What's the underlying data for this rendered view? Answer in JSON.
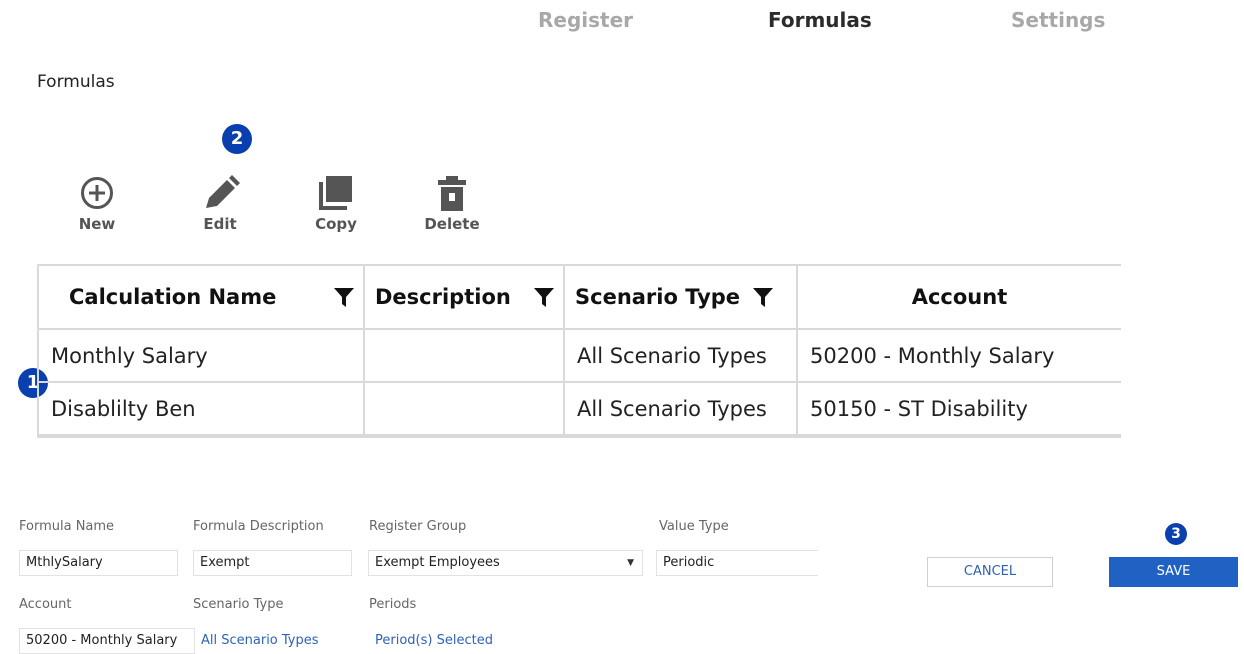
{
  "nav": {
    "tabs": [
      {
        "label": "Register"
      },
      {
        "label": "Formulas"
      },
      {
        "label": "Settings"
      }
    ],
    "active": "Formulas"
  },
  "page": {
    "title": "Formulas"
  },
  "toolbar": {
    "new_label": "New",
    "edit_label": "Edit",
    "copy_label": "Copy",
    "delete_label": "Delete"
  },
  "badges": {
    "one": "1",
    "two": "2",
    "three": "3"
  },
  "grid": {
    "columns": [
      "Calculation Name",
      "Description",
      "Scenario Type",
      "Account"
    ],
    "rows": [
      [
        "Monthly Salary",
        "",
        "All Scenario Types",
        "50200 - Monthly Salary"
      ],
      [
        "Disablilty Ben",
        "",
        "All Scenario Types",
        "50150 - ST Disability"
      ]
    ]
  },
  "form": {
    "formula_name": {
      "label": "Formula Name",
      "value": "MthlySalary"
    },
    "formula_description": {
      "label": "Formula Description",
      "value": "Exempt"
    },
    "register_group": {
      "label": "Register Group",
      "value": "Exempt Employees"
    },
    "value_type": {
      "label": "Value Type",
      "value": "Periodic"
    },
    "account": {
      "label": "Account",
      "value": "50200 - Monthly Salary"
    },
    "scenario_type": {
      "label": "Scenario Type",
      "value": "All Scenario Types"
    },
    "periods": {
      "label": "Periods",
      "value": "Period(s) Selected"
    },
    "cancel_label": "CANCEL",
    "save_label": "SAVE"
  },
  "colors": {
    "badge": "#0a3fb0",
    "save": "#1f62c4",
    "link": "#2e62b8"
  },
  "icons": {
    "new": "plus-circle-icon",
    "edit": "pencil-icon",
    "copy": "copy-icon",
    "delete": "trash-icon",
    "filter": "filter-icon"
  }
}
